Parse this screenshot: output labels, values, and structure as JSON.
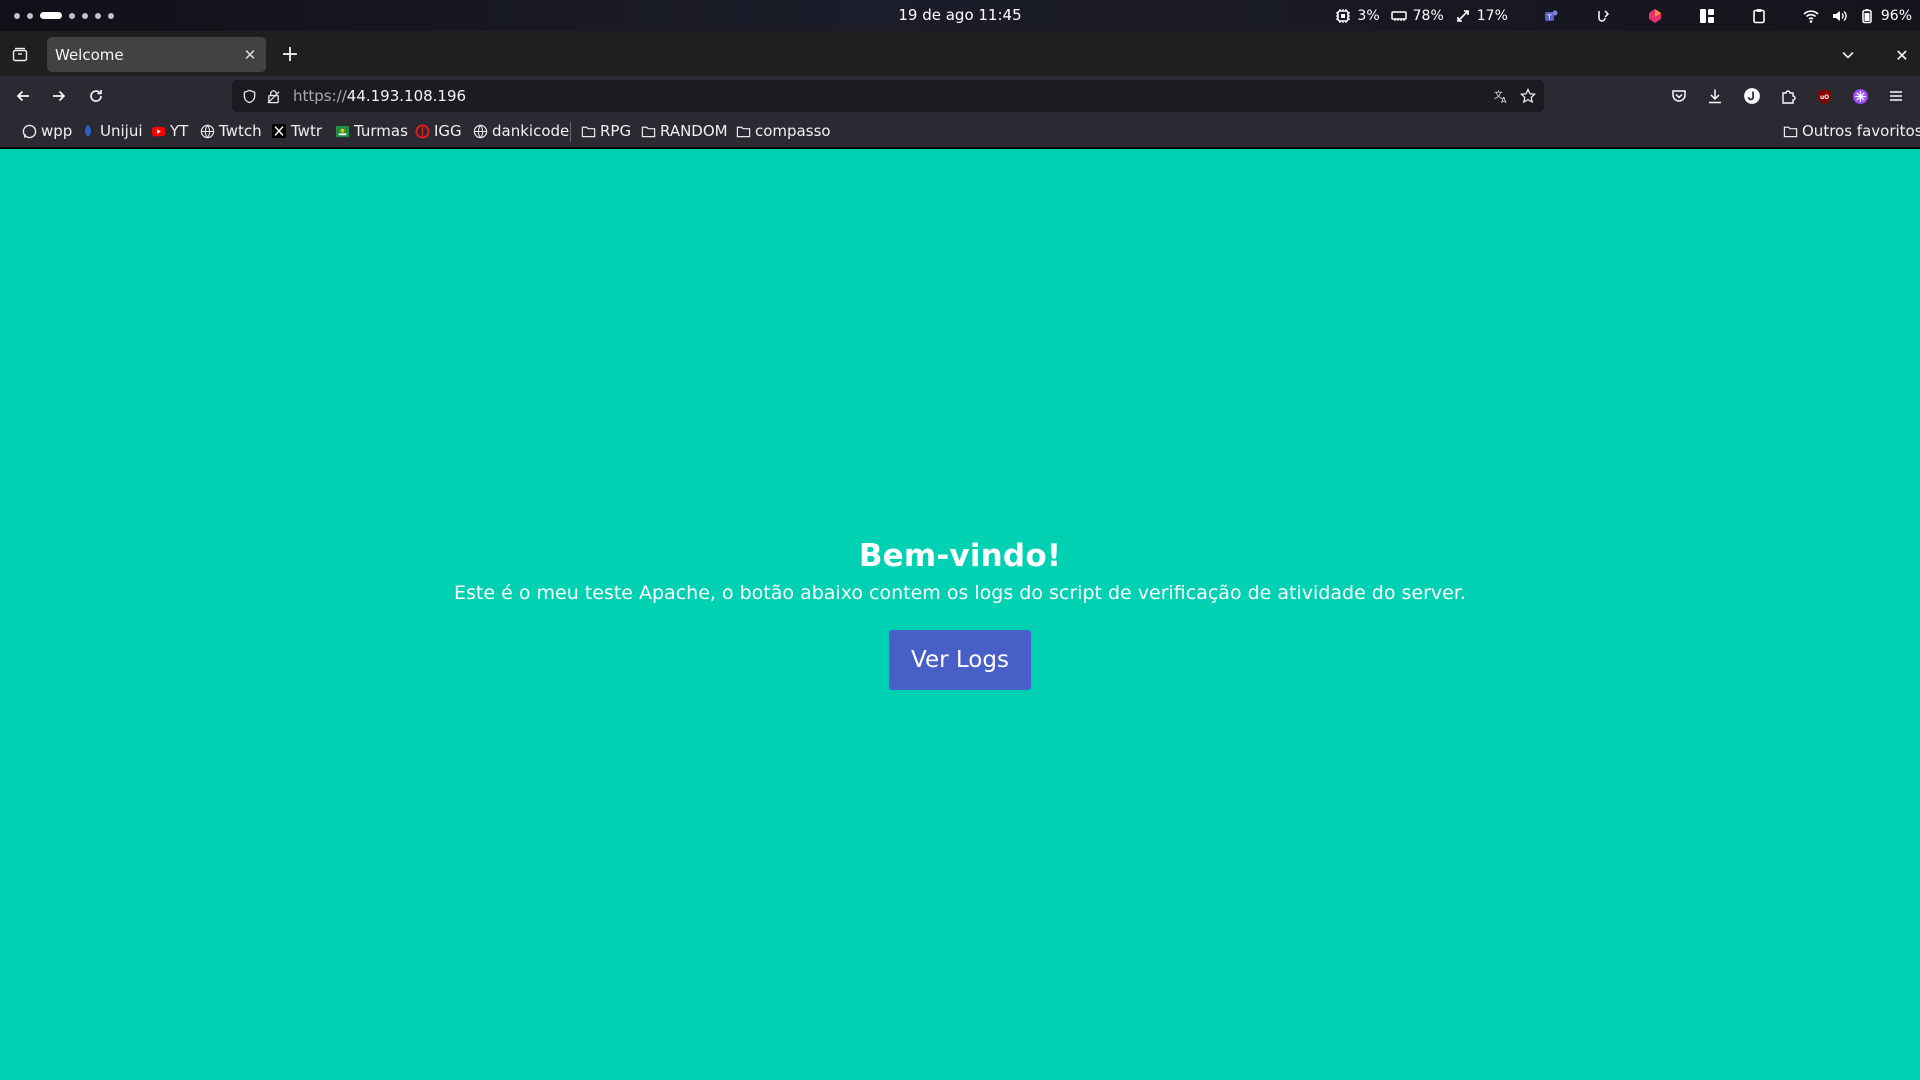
{
  "system": {
    "clock": "19 de ago  11:45",
    "cpu": "3%",
    "memory": "78%",
    "swap": "17%",
    "battery": "96%"
  },
  "browser": {
    "tab_title": "Welcome",
    "url_scheme": "https://",
    "url_host": "44.193.108.196"
  },
  "bookmarks": {
    "items": [
      "wpp",
      "Unijui",
      "YT",
      "Twtch",
      "Twtr",
      "Turmas",
      "IGG",
      "dankicode"
    ],
    "folders": [
      "RPG",
      "RANDOM",
      "compasso"
    ],
    "other": "Outros favoritos"
  },
  "page": {
    "heading": "Bem-vindo!",
    "description": "Este é o meu teste Apache, o botão abaixo contem os logs do script de verificação de atividade do server.",
    "button_label": "Ver Logs",
    "background": "#00d1b2",
    "button_color": "#485fc7"
  },
  "icons": {
    "workspaces": "workspace-dots",
    "cpu": "cpu-icon",
    "memory": "memory-icon",
    "swap": "swap-icon",
    "battery": "battery-icon"
  }
}
